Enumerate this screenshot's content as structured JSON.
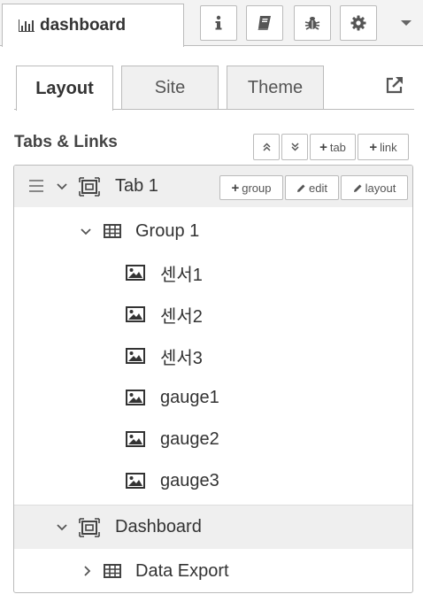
{
  "header": {
    "tab_label": "dashboard",
    "icons": [
      "info-icon",
      "book-icon",
      "bug-icon",
      "gear-icon",
      "chevron-down-icon"
    ]
  },
  "subtabs": [
    {
      "label": "Layout",
      "active": true
    },
    {
      "label": "Site",
      "active": false
    },
    {
      "label": "Theme",
      "active": false
    }
  ],
  "section": {
    "title": "Tabs & Links",
    "buttons": {
      "collapse_all": "",
      "expand_all": "",
      "add_tab": "tab",
      "add_link": "link"
    }
  },
  "tree": {
    "tab1": {
      "label": "Tab 1",
      "actions": {
        "group": "group",
        "edit": "edit",
        "layout": "layout"
      },
      "group": {
        "label": "Group 1",
        "widgets": [
          "센서1",
          "센서2",
          "센서3",
          "gauge1",
          "gauge2",
          "gauge3"
        ]
      }
    },
    "tab2": {
      "label": "Dashboard",
      "group": {
        "label": "Data Export"
      }
    }
  }
}
